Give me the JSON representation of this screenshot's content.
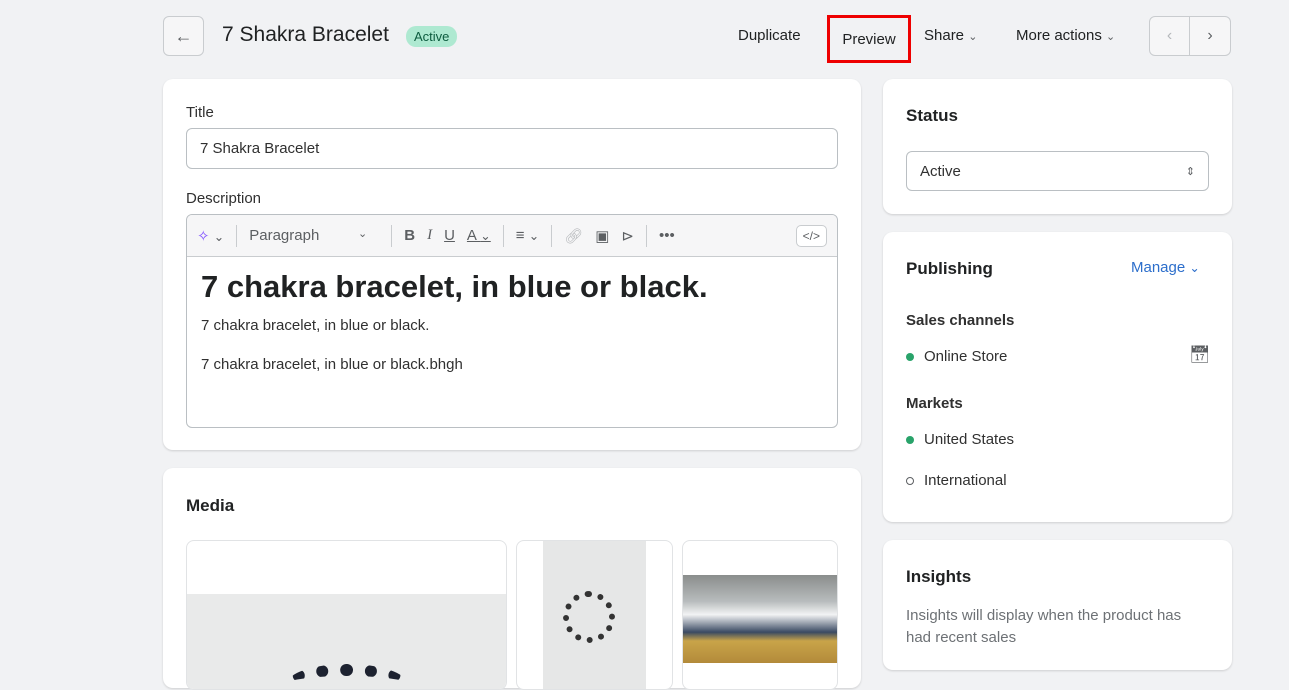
{
  "header": {
    "title": "7 Shakra Bracelet",
    "status_badge": "Active",
    "duplicate": "Duplicate",
    "preview": "Preview",
    "share": "Share",
    "more_actions": "More actions"
  },
  "product": {
    "title_label": "Title",
    "title_value": "7 Shakra Bracelet",
    "description_label": "Description",
    "toolbar": {
      "format": "Paragraph"
    },
    "description": {
      "heading": "7 chakra bracelet, in blue or black.",
      "p1": "7 chakra bracelet, in blue or black.",
      "p2": "7 chakra bracelet, in blue or black.bhgh"
    }
  },
  "media": {
    "title": "Media"
  },
  "status": {
    "title": "Status",
    "value": "Active"
  },
  "publishing": {
    "title": "Publishing",
    "manage": "Manage",
    "sales_channels_label": "Sales channels",
    "channels": [
      "Online Store"
    ],
    "markets_label": "Markets",
    "markets": [
      "United States",
      "International"
    ]
  },
  "insights": {
    "title": "Insights",
    "text": "Insights will display when the product has had recent sales"
  },
  "colors": {
    "highlight": "#ee0000",
    "badge": "#aee9d1",
    "active_dot": "#29a36a",
    "link": "#2c6ecb"
  }
}
